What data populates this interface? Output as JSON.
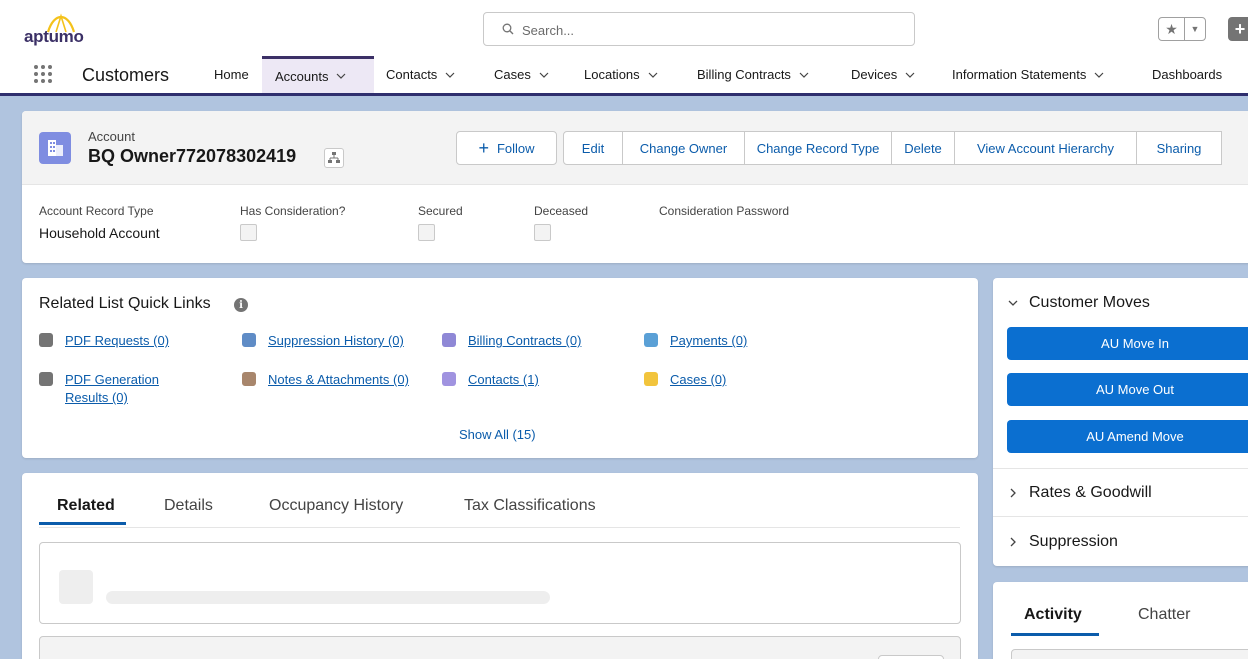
{
  "header": {
    "logo_text": "aptumo",
    "search_placeholder": "Search..."
  },
  "nav": {
    "app_name": "Customers",
    "items": [
      {
        "label": "Home"
      },
      {
        "label": "Accounts"
      },
      {
        "label": "Contacts"
      },
      {
        "label": "Cases"
      },
      {
        "label": "Locations"
      },
      {
        "label": "Billing Contracts"
      },
      {
        "label": "Devices"
      },
      {
        "label": "Information Statements"
      },
      {
        "label": "Dashboards"
      }
    ]
  },
  "record": {
    "type_label": "Account",
    "name": "BQ Owner772078302419",
    "actions": {
      "follow": "Follow",
      "edit": "Edit",
      "change_owner": "Change Owner",
      "change_record_type": "Change Record Type",
      "delete": "Delete",
      "view_hierarchy": "View Account Hierarchy",
      "sharing": "Sharing"
    },
    "fields": {
      "record_type_label": "Account Record Type",
      "record_type_value": "Household Account",
      "has_consideration_label": "Has Consideration?",
      "secured_label": "Secured",
      "deceased_label": "Deceased",
      "consideration_password_label": "Consideration Password"
    }
  },
  "quick_links": {
    "title": "Related List Quick Links",
    "links": [
      {
        "label": "PDF Requests (0)",
        "color": "#747474"
      },
      {
        "label": "Suppression History (0)",
        "color": "#5f8cc6"
      },
      {
        "label": "Billing Contracts (0)",
        "color": "#8f88d6"
      },
      {
        "label": "Payments (0)",
        "color": "#5aa0d6"
      },
      {
        "label": "PDF Generation Results (0)",
        "color": "#747474"
      },
      {
        "label": "Notes & Attachments (0)",
        "color": "#a8866c"
      },
      {
        "label": "Contacts (1)",
        "color": "#a093e0"
      },
      {
        "label": "Cases (0)",
        "color": "#f2c43c"
      }
    ],
    "show_all": "Show All (15)"
  },
  "tabs": {
    "related": "Related",
    "details": "Details",
    "occupancy_history": "Occupancy History",
    "tax_classifications": "Tax Classifications"
  },
  "side": {
    "customer_moves": "Customer Moves",
    "move_in": "AU Move In",
    "move_out": "AU Move Out",
    "amend_move": "AU Amend Move",
    "rates_goodwill": "Rates & Goodwill",
    "suppression": "Suppression"
  },
  "activity": {
    "activity_tab": "Activity",
    "chatter_tab": "Chatter"
  },
  "colors": {
    "brand_blue": "#0b5cab",
    "button_blue": "#0b6fd0",
    "nav_accent": "#3b3066",
    "account_icon": "#7f8de1"
  }
}
